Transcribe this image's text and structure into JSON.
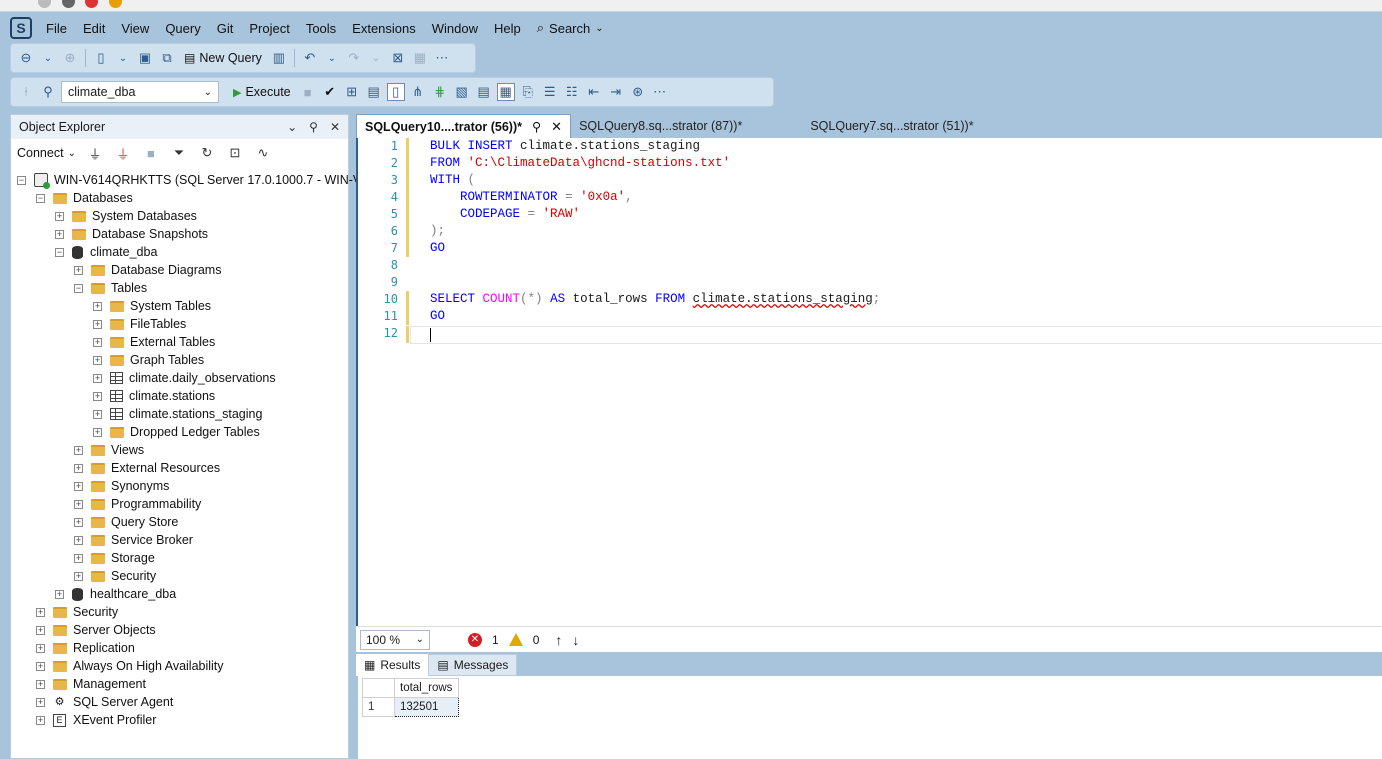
{
  "menu": [
    "File",
    "Edit",
    "View",
    "Query",
    "Git",
    "Project",
    "Tools",
    "Extensions",
    "Window",
    "Help"
  ],
  "search_label": "Search",
  "toolbar": {
    "new_query": "New Query",
    "database": "climate_dba",
    "execute": "Execute"
  },
  "object_explorer": {
    "title": "Object Explorer",
    "connect": "Connect",
    "server": "WIN-V614QRHKTTS (SQL Server 17.0.1000.7 - WIN-V614C",
    "items": [
      {
        "label": "Databases"
      },
      {
        "label": "System Databases"
      },
      {
        "label": "Database Snapshots"
      },
      {
        "label": "climate_dba"
      },
      {
        "label": "Database Diagrams"
      },
      {
        "label": "Tables"
      },
      {
        "label": "System Tables"
      },
      {
        "label": "FileTables"
      },
      {
        "label": "External Tables"
      },
      {
        "label": "Graph Tables"
      },
      {
        "label": "climate.daily_observations"
      },
      {
        "label": "climate.stations"
      },
      {
        "label": "climate.stations_staging"
      },
      {
        "label": "Dropped Ledger Tables"
      },
      {
        "label": "Views"
      },
      {
        "label": "External Resources"
      },
      {
        "label": "Synonyms"
      },
      {
        "label": "Programmability"
      },
      {
        "label": "Query Store"
      },
      {
        "label": "Service Broker"
      },
      {
        "label": "Storage"
      },
      {
        "label": "Security"
      },
      {
        "label": "healthcare_dba"
      },
      {
        "label": "Security"
      },
      {
        "label": "Server Objects"
      },
      {
        "label": "Replication"
      },
      {
        "label": "Always On High Availability"
      },
      {
        "label": "Management"
      },
      {
        "label": "SQL Server Agent"
      },
      {
        "label": "XEvent Profiler"
      }
    ]
  },
  "tabs": [
    {
      "label": "SQLQuery10....trator (56))*"
    },
    {
      "label": "SQLQuery8.sq...strator (87))*"
    },
    {
      "label": "SQLQuery7.sq...strator (51))*"
    }
  ],
  "editor": {
    "line_numbers": [
      "1",
      "2",
      "3",
      "4",
      "5",
      "6",
      "7",
      "8",
      "9",
      "10",
      "11",
      "12"
    ],
    "code": {
      "l1_kw": "BULK INSERT",
      "l1_rest": " climate.stations_staging",
      "l2_kw": "FROM",
      "l2_str": "'C:\\ClimateData\\ghcnd-stations.txt'",
      "l3_kw": "WITH",
      "l3_p": " (",
      "l4_kw": "ROWTERMINATOR",
      "l4_eq": " = ",
      "l4_str": "'0x0a'",
      "l4_c": ",",
      "l5_kw": "CODEPAGE",
      "l5_eq": " = ",
      "l5_str": "'RAW'",
      "l6": ");",
      "l7": "GO",
      "l10_kw1": "SELECT",
      "l10_fn": "COUNT",
      "l10_args": "(*)",
      "l10_kw2": "AS",
      "l10_col": "total_rows",
      "l10_kw3": "FROM",
      "l10_tbl": "climate.stations_staging",
      "l10_semi": ";",
      "l11": "GO"
    }
  },
  "status": {
    "zoom": "100 %",
    "errors": "1",
    "warnings": "0"
  },
  "results": {
    "tabs": [
      "Results",
      "Messages"
    ],
    "columns": [
      "total_rows"
    ],
    "rows": [
      {
        "num": "1",
        "value": "132501"
      }
    ]
  }
}
